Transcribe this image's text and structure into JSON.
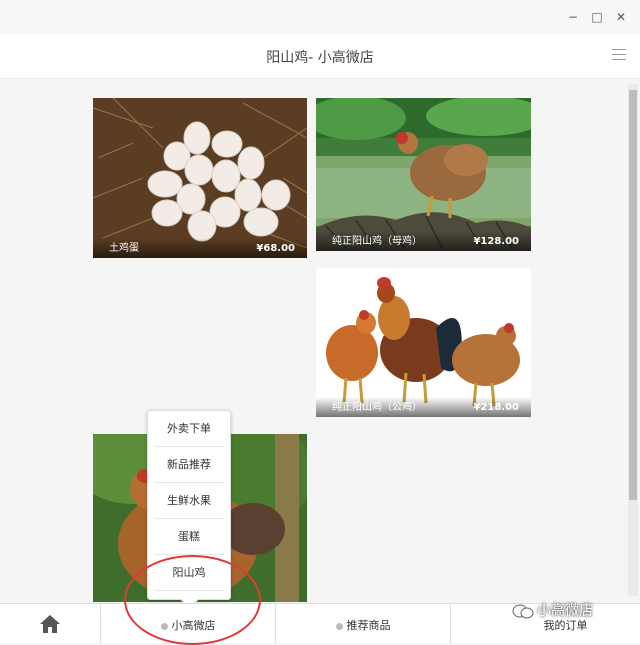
{
  "window": {
    "minimize_glyph": "−",
    "maximize_glyph": "□",
    "close_glyph": "✕"
  },
  "header": {
    "title": "阳山鸡- 小高微店"
  },
  "products": [
    {
      "name": "土鸡蛋",
      "price": "¥68.00"
    },
    {
      "name": "纯正阳山鸡（母鸡）",
      "price": "¥128.00"
    },
    {
      "name": "纯正阳山鸡（公鸡）",
      "price": "¥218.00"
    }
  ],
  "popup_menu": {
    "items": [
      "外卖下单",
      "新品推荐",
      "生鲜水果",
      "蛋糕",
      "阳山鸡"
    ]
  },
  "tabbar": {
    "home_icon": "home-icon",
    "tab1": "小高微店",
    "tab2": "推荐商品",
    "tab3": "我的订单"
  },
  "watermark": "小高微店",
  "colors": {
    "annotation_circle": "#e03a3a",
    "accent_green": "#2f7a2a"
  }
}
